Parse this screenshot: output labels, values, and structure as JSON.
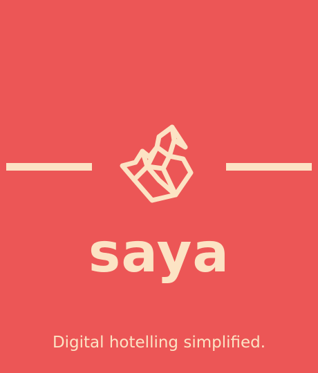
{
  "brand": {
    "name": "saya",
    "tagline": "Digital hotelling simplified.",
    "logo_icon": "origami-swan-icon"
  },
  "colors": {
    "background": "#EC5656",
    "foreground": "#FCE3C4"
  }
}
